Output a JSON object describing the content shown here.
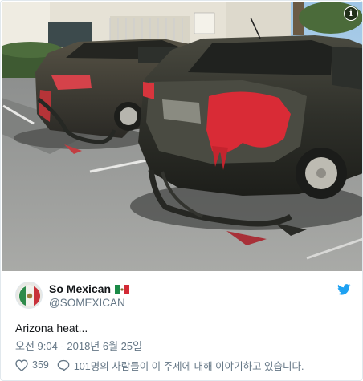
{
  "media": {
    "info_icon": "info-icon"
  },
  "author": {
    "display_name": "So Mexican",
    "handle": "@SOMEXICAN",
    "flag_icon": "mexico-flag-icon",
    "brand_icon": "twitter-bird-icon",
    "brand_color": "#1da1f2"
  },
  "tweet": {
    "text": "Arizona heat...",
    "timestamp": "오전 9:04 - 2018년 6월 25일"
  },
  "actions": {
    "like_count": "359",
    "conversation_text": "101명의 사람들이 이 주제에 대해 이야기하고 있습니다."
  }
}
